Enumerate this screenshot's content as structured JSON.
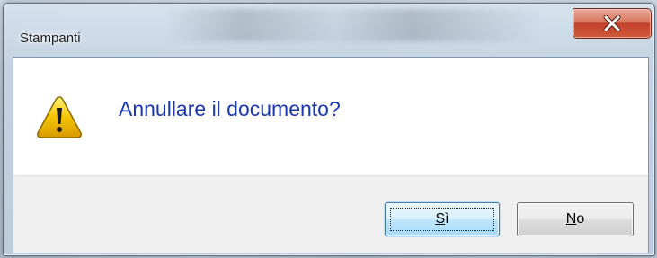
{
  "window": {
    "title": "Stampanti",
    "close_icon": "close-icon"
  },
  "dialog": {
    "icon": "warning-icon",
    "message": "Annullare il documento?"
  },
  "buttons": {
    "yes": {
      "accel": "S",
      "rest": "ì",
      "focused": true
    },
    "no": {
      "accel": "N",
      "rest": "o"
    }
  },
  "colors": {
    "message_text": "#1b38b3",
    "close_button": "#c2412a",
    "warning_fill": "#f5c400"
  }
}
